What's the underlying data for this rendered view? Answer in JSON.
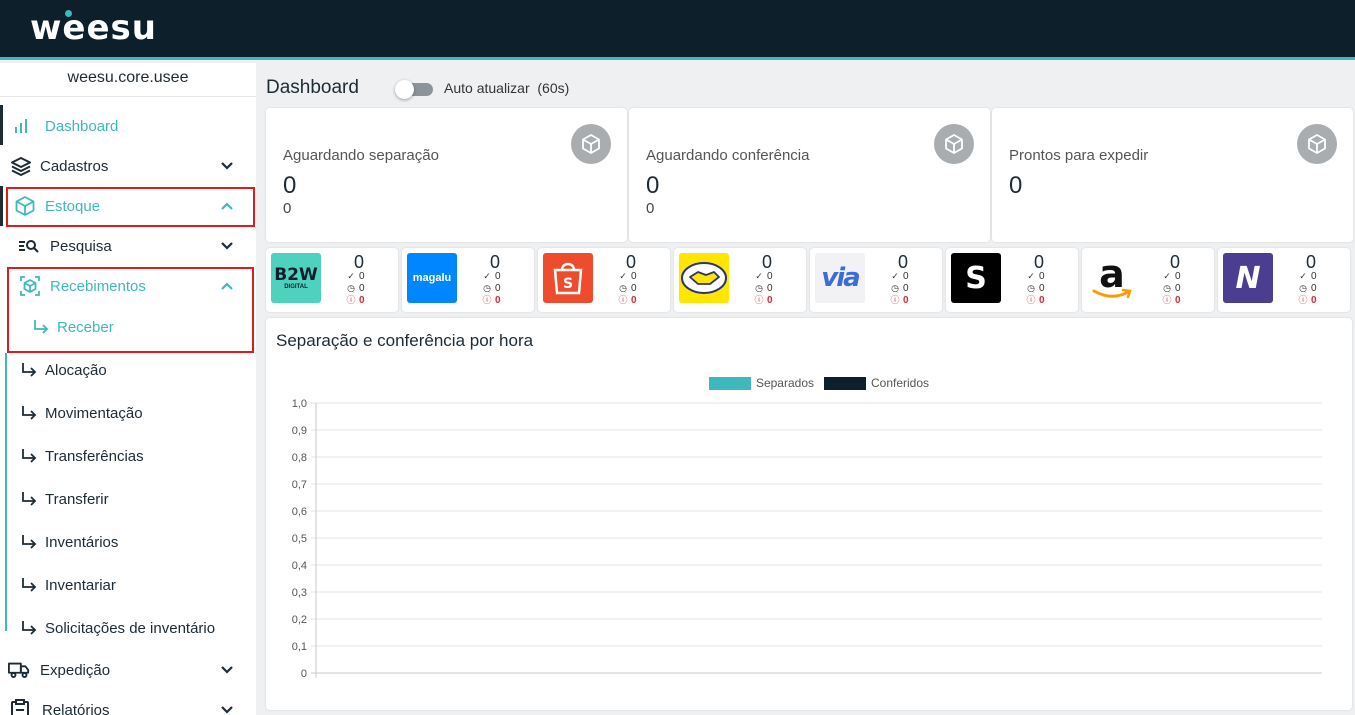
{
  "header": {
    "logo_text": "weesu"
  },
  "sidebar": {
    "tenant": "weesu.core.usee",
    "dashboard": "Dashboard",
    "cadastros": "Cadastros",
    "estoque": "Estoque",
    "pesquisa": "Pesquisa",
    "recebimentos": "Recebimentos",
    "receber": "Receber",
    "alocacao": "Alocação",
    "movimentacao": "Movimentação",
    "transferencias": "Transferências",
    "transferir": "Transferir",
    "inventarios": "Inventários",
    "inventariar": "Inventariar",
    "solicitacoes": "Solicitações de inventário",
    "expedicao": "Expedição",
    "relatorios": "Relatórios"
  },
  "main": {
    "title": "Dashboard",
    "auto_update_label": "Auto atualizar",
    "auto_update_interval": "(60s)",
    "auto_update_on": false
  },
  "status_cards": [
    {
      "title": "Aguardando separação",
      "value": "0",
      "sub": "0"
    },
    {
      "title": "Aguardando conferência",
      "value": "0",
      "sub": "0"
    },
    {
      "title": "Prontos para expedir",
      "value": "0",
      "sub": ""
    }
  ],
  "marketplaces": [
    {
      "name": "b2w-digital",
      "logo_text": "B2W",
      "logo_sub": "DIGITAL",
      "bg": "#4fd1c0",
      "count": "0",
      "done": "0",
      "pending": "0",
      "errors": "0"
    },
    {
      "name": "magalu",
      "logo_text": "magalu",
      "bg": "#0086ff",
      "count": "0",
      "done": "0",
      "pending": "0",
      "errors": "0"
    },
    {
      "name": "shopee",
      "logo_text": "S",
      "bg": "#ee4d2d",
      "count": "0",
      "done": "0",
      "pending": "0",
      "errors": "0"
    },
    {
      "name": "mercado-livre",
      "logo_text": "",
      "bg": "#ffe600",
      "count": "0",
      "done": "0",
      "pending": "0",
      "errors": "0"
    },
    {
      "name": "via",
      "logo_text": "via",
      "bg": "#f2f2f4",
      "count": "0",
      "done": "0",
      "pending": "0",
      "errors": "0"
    },
    {
      "name": "shein",
      "logo_text": "S",
      "bg": "#000000",
      "count": "0",
      "done": "0",
      "pending": "0",
      "errors": "0"
    },
    {
      "name": "amazon",
      "logo_text": "a",
      "bg": "#ffffff",
      "count": "0",
      "done": "0",
      "pending": "0",
      "errors": "0"
    },
    {
      "name": "nuvemshop",
      "logo_text": "N",
      "bg": "#4b3d8f",
      "count": "0",
      "done": "0",
      "pending": "0",
      "errors": "0"
    }
  ],
  "chart_data": {
    "type": "bar",
    "title": "Separação e conferência por hora",
    "categories": [],
    "series": [
      {
        "name": "Separados",
        "values": [],
        "color": "#3fb8bd"
      },
      {
        "name": "Conferidos",
        "values": [],
        "color": "#0d1f2a"
      }
    ],
    "ylim": [
      0,
      1
    ],
    "yticks": [
      "1,0",
      "0,9",
      "0,8",
      "0,7",
      "0,6",
      "0,5",
      "0,4",
      "0,3",
      "0,2",
      "0,1",
      "0"
    ],
    "legend": "top",
    "grid": true
  },
  "colors": {
    "accent": "#3fb8bd",
    "dark": "#0d1f2a",
    "highlight": "#e01b1b",
    "error": "#d7263d"
  }
}
